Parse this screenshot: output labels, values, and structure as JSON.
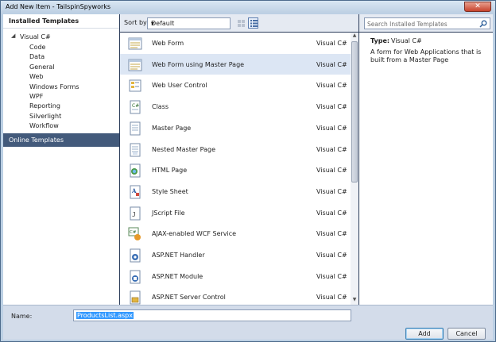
{
  "window": {
    "title": "Add New Item - TailspinSpyworks",
    "close_glyph": "✕"
  },
  "left_pane": {
    "header": "Installed Templates",
    "root": {
      "arrow": "◢",
      "label": "Visual C#"
    },
    "children": [
      "Code",
      "Data",
      "General",
      "Web",
      "Windows Forms",
      "WPF",
      "Reporting",
      "Silverlight",
      "Workflow"
    ],
    "online": "Online Templates"
  },
  "toolbar": {
    "sort_label": "Sort by:",
    "sort_value": "Default",
    "sort_arrow": "▾"
  },
  "templates": [
    {
      "name": "Web Form",
      "lang": "Visual C#",
      "icon": "web-form-icon"
    },
    {
      "name": "Web Form using Master Page",
      "lang": "Visual C#",
      "icon": "web-form-master-icon",
      "selected": true
    },
    {
      "name": "Web User Control",
      "lang": "Visual C#",
      "icon": "user-control-icon"
    },
    {
      "name": "Class",
      "lang": "Visual C#",
      "icon": "class-icon"
    },
    {
      "name": "Master Page",
      "lang": "Visual C#",
      "icon": "master-page-icon"
    },
    {
      "name": "Nested Master Page",
      "lang": "Visual C#",
      "icon": "nested-master-icon"
    },
    {
      "name": "HTML Page",
      "lang": "Visual C#",
      "icon": "html-page-icon"
    },
    {
      "name": "Style Sheet",
      "lang": "Visual C#",
      "icon": "style-sheet-icon"
    },
    {
      "name": "JScript File",
      "lang": "Visual C#",
      "icon": "jscript-icon"
    },
    {
      "name": "AJAX-enabled WCF Service",
      "lang": "Visual C#",
      "icon": "wcf-service-icon"
    },
    {
      "name": "ASP.NET Handler",
      "lang": "Visual C#",
      "icon": "handler-icon"
    },
    {
      "name": "ASP.NET Module",
      "lang": "Visual C#",
      "icon": "module-icon"
    },
    {
      "name": "ASP.NET Server Control",
      "lang": "Visual C#",
      "icon": "server-control-icon"
    }
  ],
  "search": {
    "placeholder": "Search Installed Templates"
  },
  "details": {
    "type_label": "Type:",
    "type_value": "Visual C#",
    "description": "A form for Web Applications that is built from a Master Page"
  },
  "bottom": {
    "name_label": "Name:",
    "name_value": "ProductsList.aspx",
    "add_label": "Add",
    "cancel_label": "Cancel"
  },
  "colors": {
    "selection": "#dce6f4",
    "online_bg": "#435a7b",
    "frame": "#2b3c59"
  }
}
